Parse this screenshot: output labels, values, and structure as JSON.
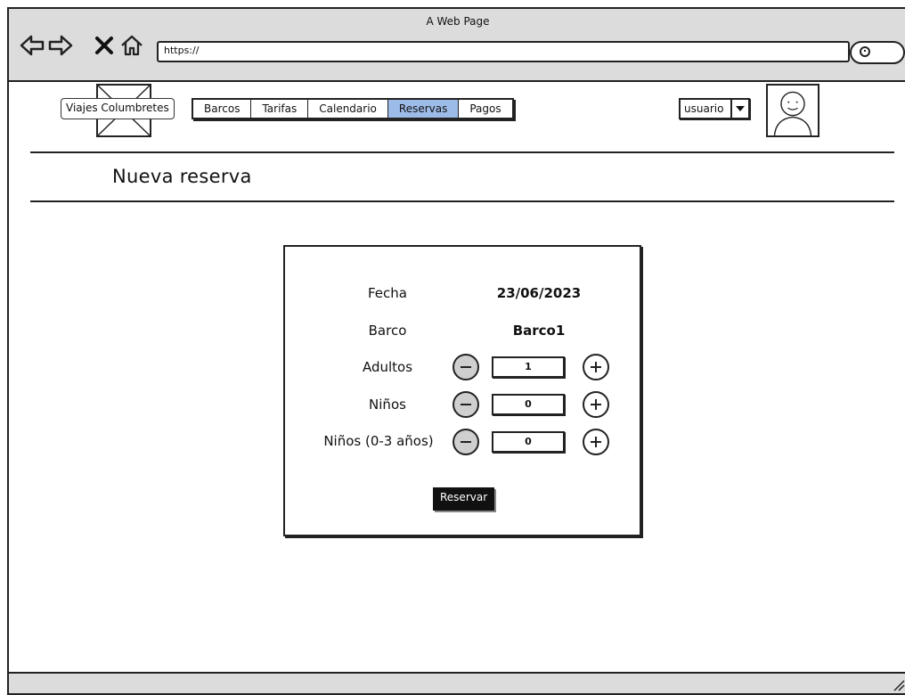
{
  "window": {
    "title": "A Web Page"
  },
  "browser": {
    "url": "https://"
  },
  "header": {
    "brand": "Viajes Columbretes",
    "tabs": [
      {
        "label": "Barcos",
        "active": false
      },
      {
        "label": "Tarifas",
        "active": false
      },
      {
        "label": "Calendario",
        "active": false
      },
      {
        "label": "Reservas",
        "active": true
      },
      {
        "label": "Pagos",
        "active": false
      }
    ],
    "user_select": "usuario"
  },
  "page": {
    "title": "Nueva reserva"
  },
  "form": {
    "fecha_label": "Fecha",
    "fecha_value": "23/06/2023",
    "barco_label": "Barco",
    "barco_value": "Barco1",
    "adultos_label": "Adultos",
    "adultos_value": "1",
    "ninos_label": "Niños",
    "ninos_value": "0",
    "bebes_label": "Niños (0-3 años)",
    "bebes_value": "0",
    "submit_label": "Reservar"
  },
  "colors": {
    "active_tab": "#9dbbe8",
    "chrome": "#dcdcdc",
    "submit_bg": "#111111"
  },
  "icons": [
    "back-icon",
    "forward-icon",
    "close-icon",
    "home-icon",
    "search-icon",
    "image-placeholder-icon",
    "avatar-icon",
    "chevron-down-icon",
    "minus-icon",
    "plus-icon",
    "resize-icon"
  ]
}
